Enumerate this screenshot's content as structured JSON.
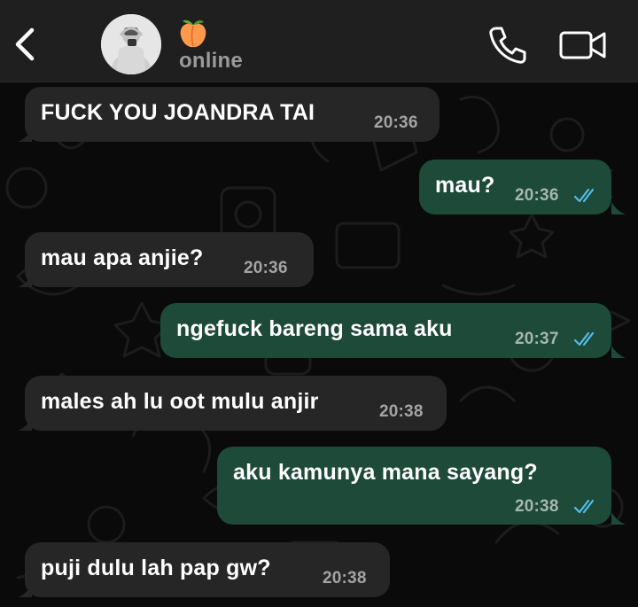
{
  "header": {
    "contact_emoji": "🍑",
    "status": "online",
    "icons": {
      "back": "chevron-left-icon",
      "call": "phone-icon",
      "video": "video-camera-icon"
    }
  },
  "colors": {
    "header_bg": "#1f1f1f",
    "chat_bg": "#0a0a0a",
    "incoming_bubble": "#262626",
    "outgoing_bubble": "#1d4a39",
    "read_ticks": "#53bdeb"
  },
  "messages": [
    {
      "direction": "in",
      "text": "FUCK YOU JOANDRA TAI",
      "time": "20:36"
    },
    {
      "direction": "out",
      "text": "mau?",
      "time": "20:36",
      "read": true
    },
    {
      "direction": "in",
      "text": "mau apa anjie?",
      "time": "20:36"
    },
    {
      "direction": "out",
      "text": "ngefuck bareng sama aku",
      "time": "20:37",
      "read": true
    },
    {
      "direction": "in",
      "text": "males ah lu oot mulu anjir",
      "time": "20:38"
    },
    {
      "direction": "out",
      "text": "aku kamunya mana sayang?",
      "time": "20:38",
      "read": true
    },
    {
      "direction": "in",
      "text": "puji dulu lah pap gw?",
      "time": "20:38"
    }
  ]
}
